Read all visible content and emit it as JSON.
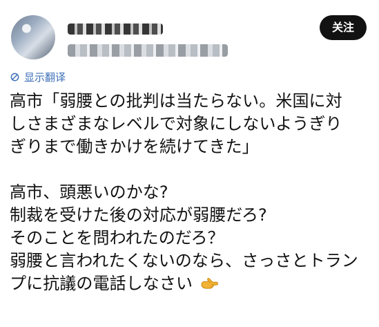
{
  "post": {
    "follow_label": "关注",
    "translate_label": "显示翻译",
    "content": {
      "quote_lines": [
        "高市「弱腰との批判は当たらない。米国に対",
        "しさまざまなレベルで対象にしないようぎり",
        "ぎりまで働きかけを続けてきた」"
      ],
      "comment_lines": [
        "高市、頭悪いのかな?",
        "制裁を受けた後の対応が弱腰だろ?",
        "そのことを問われたのだろ？",
        "弱腰と言われたくないのなら、さっさとトラン",
        "プに抗議の電話しなさい"
      ],
      "emoji": "pointing-right-hand-emoji"
    }
  }
}
